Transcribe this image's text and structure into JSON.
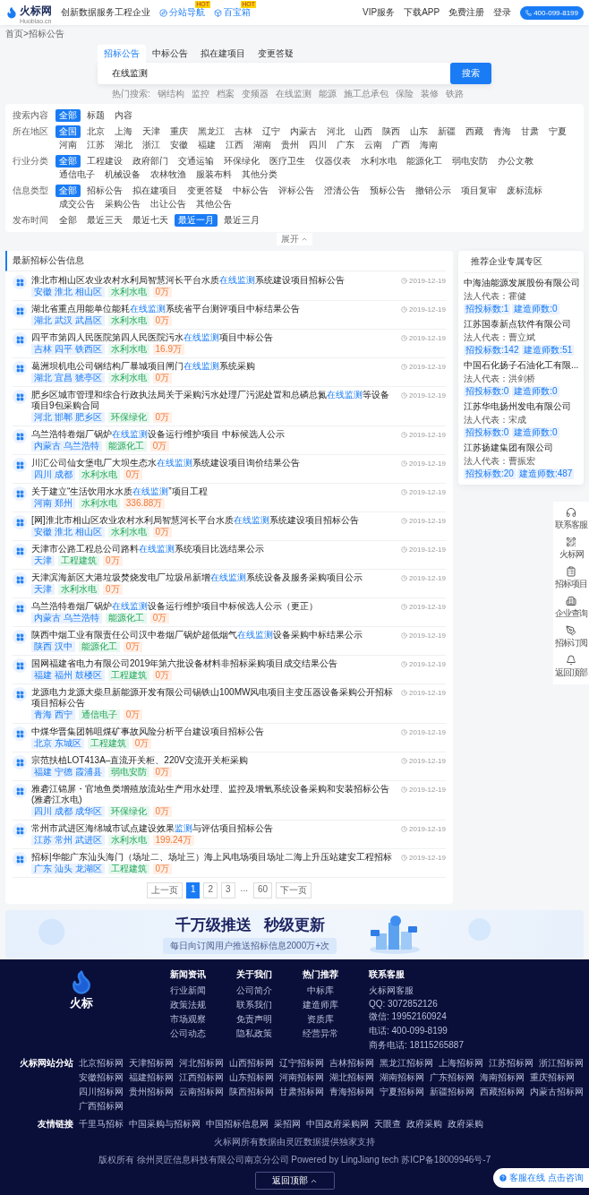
{
  "header": {
    "logo": "火标网",
    "logo_sub": "Huobiao.cn",
    "slogan": "创新数据服务工程企业",
    "nav": [
      {
        "label": "分站导航",
        "badge": "HOT",
        "kind": "compass"
      },
      {
        "label": "百宝箱",
        "badge": "HOT",
        "kind": "box"
      }
    ],
    "links": [
      "VIP服务",
      "下载APP"
    ],
    "register": "免费注册",
    "login": "登录",
    "phone": "400-099-8199"
  },
  "breadcrumb": "首页>招标公告",
  "search": {
    "tabs": [
      {
        "label": "招标公告",
        "selected": true
      },
      {
        "label": "中标公告",
        "selected": false
      },
      {
        "label": "拟在建项目",
        "selected": false
      },
      {
        "label": "变更答疑",
        "selected": false
      }
    ],
    "value": "在线监测",
    "button": "搜索",
    "hot_label": "热门搜索:",
    "hot": [
      "钢结构",
      "监控",
      "档案",
      "变频器",
      "在线监测",
      "能源",
      "施工总承包",
      "保险",
      "装修",
      "铁路"
    ]
  },
  "filters": [
    {
      "label": "搜索内容",
      "options": [
        {
          "label": "全部",
          "selected": true
        },
        {
          "label": "标题",
          "selected": false
        },
        {
          "label": "内容",
          "selected": false
        }
      ]
    },
    {
      "label": "所在地区",
      "options": [
        {
          "label": "全国",
          "selected": true
        },
        {
          "label": "北京",
          "selected": false
        },
        {
          "label": "上海",
          "selected": false
        },
        {
          "label": "天津",
          "selected": false
        },
        {
          "label": "重庆",
          "selected": false
        },
        {
          "label": "黑龙江",
          "selected": false
        },
        {
          "label": "吉林",
          "selected": false
        },
        {
          "label": "辽宁",
          "selected": false
        },
        {
          "label": "内蒙古",
          "selected": false
        },
        {
          "label": "河北",
          "selected": false
        },
        {
          "label": "山西",
          "selected": false
        },
        {
          "label": "陕西",
          "selected": false
        },
        {
          "label": "山东",
          "selected": false
        },
        {
          "label": "新疆",
          "selected": false
        },
        {
          "label": "西藏",
          "selected": false
        },
        {
          "label": "青海",
          "selected": false
        },
        {
          "label": "甘肃",
          "selected": false
        },
        {
          "label": "宁夏",
          "selected": false
        },
        {
          "label": "河南",
          "selected": false
        },
        {
          "label": "江苏",
          "selected": false
        },
        {
          "label": "湖北",
          "selected": false
        },
        {
          "label": "浙江",
          "selected": false
        },
        {
          "label": "安徽",
          "selected": false
        },
        {
          "label": "福建",
          "selected": false
        },
        {
          "label": "江西",
          "selected": false
        },
        {
          "label": "湖南",
          "selected": false
        },
        {
          "label": "贵州",
          "selected": false
        },
        {
          "label": "四川",
          "selected": false
        },
        {
          "label": "广东",
          "selected": false
        },
        {
          "label": "云南",
          "selected": false
        },
        {
          "label": "广西",
          "selected": false
        },
        {
          "label": "海南",
          "selected": false
        }
      ]
    },
    {
      "label": "行业分类",
      "options": [
        {
          "label": "全部",
          "selected": true
        },
        {
          "label": "工程建设",
          "selected": false
        },
        {
          "label": "政府部门",
          "selected": false
        },
        {
          "label": "交通运输",
          "selected": false
        },
        {
          "label": "环保绿化",
          "selected": false
        },
        {
          "label": "医疗卫生",
          "selected": false
        },
        {
          "label": "仪器仪表",
          "selected": false
        },
        {
          "label": "水利水电",
          "selected": false
        },
        {
          "label": "能源化工",
          "selected": false
        },
        {
          "label": "弱电安防",
          "selected": false
        },
        {
          "label": "办公文教",
          "selected": false
        },
        {
          "label": "通信电子",
          "selected": false
        },
        {
          "label": "机械设备",
          "selected": false
        },
        {
          "label": "农林牧渔",
          "selected": false
        },
        {
          "label": "服装布料",
          "selected": false
        },
        {
          "label": "其他分类",
          "selected": false
        }
      ]
    },
    {
      "label": "信息类型",
      "options": [
        {
          "label": "全部",
          "selected": true
        },
        {
          "label": "招标公告",
          "selected": false
        },
        {
          "label": "拟在建项目",
          "selected": false
        },
        {
          "label": "变更答疑",
          "selected": false
        },
        {
          "label": "中标公告",
          "selected": false
        },
        {
          "label": "评标公告",
          "selected": false
        },
        {
          "label": "澄清公告",
          "selected": false
        },
        {
          "label": "预标公告",
          "selected": false
        },
        {
          "label": "撤销公示",
          "selected": false
        },
        {
          "label": "项目复审",
          "selected": false
        },
        {
          "label": "废标流标",
          "selected": false
        },
        {
          "label": "成交公告",
          "selected": false
        },
        {
          "label": "采购公告",
          "selected": false
        },
        {
          "label": "出让公告",
          "selected": false
        },
        {
          "label": "其他公告",
          "selected": false
        }
      ]
    },
    {
      "label": "发布时间",
      "options": [
        {
          "label": "全部",
          "selected": false
        },
        {
          "label": "最近三天",
          "selected": false
        },
        {
          "label": "最近七天",
          "selected": false
        },
        {
          "label": "最近一月",
          "selected": true
        },
        {
          "label": "最近三月",
          "selected": false
        }
      ]
    }
  ],
  "expand": "展开",
  "list": {
    "title": "最新招标公告信息",
    "items": [
      {
        "title": "淮北市相山区农业农村水利局智慧河长平台水质**在线监测**系统建设项目招标公告",
        "date": "2019-12-19",
        "tags": [
          {
            "kind": "region",
            "text": "安徽 淮北 相山区"
          },
          {
            "kind": "industry",
            "text": "水利水电"
          },
          {
            "kind": "amount",
            "text": "0万"
          }
        ]
      },
      {
        "title": "湖北省重点用能单位能耗**在线监测**系统省平台测评项目中标结果公告",
        "date": "2019-12-19",
        "tags": [
          {
            "kind": "region",
            "text": "湖北 武汉 武昌区"
          },
          {
            "kind": "industry",
            "text": "水利水电"
          },
          {
            "kind": "amount",
            "text": "0万"
          }
        ]
      },
      {
        "title": "四平市第四人民医院第四人民医院污水**在线监测**项目中标公告",
        "date": "2019-12-19",
        "tags": [
          {
            "kind": "region",
            "text": "吉林 四平 铁西区"
          },
          {
            "kind": "industry",
            "text": "水利水电"
          },
          {
            "kind": "amount",
            "text": "16.9万"
          }
        ]
      },
      {
        "title": "葛洲坝机电公司钢结构厂暴城项目闸门**在线监测**系统采购",
        "date": "2019-12-19",
        "tags": [
          {
            "kind": "region",
            "text": "湖北 宜昌 猇亭区"
          },
          {
            "kind": "industry",
            "text": "水利水电"
          },
          {
            "kind": "amount",
            "text": "0万"
          }
        ]
      },
      {
        "title": "肥乡区城市管理和综合行政执法局关于采购污水处理厂污泥处置和总磷总氮**在线监测**等设备项目9包采购合同",
        "date": "2019-12-19",
        "tags": [
          {
            "kind": "region",
            "text": "河北 邯郸 肥乡区"
          },
          {
            "kind": "industry",
            "text": "环保绿化"
          },
          {
            "kind": "amount",
            "text": "0万"
          }
        ]
      },
      {
        "title": "乌兰浩特卷烟厂锅炉**在线监测**设备运行维护项目 中标候选人公示",
        "date": "2019-12-19",
        "tags": [
          {
            "kind": "region",
            "text": "内蒙古 乌兰浩特"
          },
          {
            "kind": "industry",
            "text": "能源化工"
          },
          {
            "kind": "amount",
            "text": "0万"
          }
        ]
      },
      {
        "title": "川汇公司仙女堡电厂大坝生态水**在线监测**系统建设项目询价结果公告",
        "date": "2019-12-19",
        "tags": [
          {
            "kind": "region",
            "text": "四川 成都"
          },
          {
            "kind": "industry",
            "text": "水利水电"
          },
          {
            "kind": "amount",
            "text": "0万"
          }
        ]
      },
      {
        "title": "关于建立“生活饮用水水质**在线监测**”项目工程",
        "date": "2019-12-19",
        "tags": [
          {
            "kind": "region",
            "text": "河南 郑州"
          },
          {
            "kind": "industry",
            "text": "水利水电"
          },
          {
            "kind": "amount",
            "text": "336.88万"
          }
        ]
      },
      {
        "title": "[网]淮北市相山区农业农村水利局智慧河长平台水质**在线监测**系统建设项目招标公告",
        "date": "2019-12-19",
        "tags": [
          {
            "kind": "region",
            "text": "安徽 淮北 相山区"
          },
          {
            "kind": "industry",
            "text": "水利水电"
          },
          {
            "kind": "amount",
            "text": "0万"
          }
        ]
      },
      {
        "title": "天津市公路工程总公司路料**在线监测**系统项目比选结果公示",
        "date": "2019-12-19",
        "tags": [
          {
            "kind": "region",
            "text": "天津"
          },
          {
            "kind": "industry",
            "text": "工程建筑"
          },
          {
            "kind": "amount",
            "text": "0万"
          }
        ]
      },
      {
        "title": "天津滨海新区大港垃圾焚烧发电厂垃圾吊新增**在线监测**系统设备及服务采购项目公示",
        "date": "2019-12-19",
        "tags": [
          {
            "kind": "region",
            "text": "天津"
          },
          {
            "kind": "industry",
            "text": "水利水电"
          },
          {
            "kind": "amount",
            "text": "0万"
          }
        ]
      },
      {
        "title": "乌兰浩特卷烟厂锅炉**在线监测**设备运行维护项目中标候选人公示（更正）",
        "date": "2019-12-19",
        "tags": [
          {
            "kind": "region",
            "text": "内蒙古 乌兰浩特"
          },
          {
            "kind": "industry",
            "text": "能源化工"
          },
          {
            "kind": "amount",
            "text": "0万"
          }
        ]
      },
      {
        "title": "陕西中烟工业有限责任公司汉中卷烟厂锅炉超低烟气**在线监测**设备采购中标结果公示",
        "date": "2019-12-19",
        "tags": [
          {
            "kind": "region",
            "text": "陕西 汉中"
          },
          {
            "kind": "industry",
            "text": "能源化工"
          },
          {
            "kind": "amount",
            "text": "0万"
          }
        ]
      },
      {
        "title": "国网福建省电力有限公司2019年第六批设备材料非招标采购项目成交结果公告",
        "date": "2019-12-19",
        "tags": [
          {
            "kind": "region",
            "text": "福建 福州 鼓楼区"
          },
          {
            "kind": "industry",
            "text": "工程建筑"
          },
          {
            "kind": "amount",
            "text": "0万"
          }
        ]
      },
      {
        "title": "龙源电力龙源大柴旦新能源开发有限公司锡铁山100MW风电项目主变压器设备采购公开招标项目招标公告",
        "date": "2019-12-19",
        "tags": [
          {
            "kind": "region",
            "text": "青海 西宁"
          },
          {
            "kind": "industry",
            "text": "通信电子"
          },
          {
            "kind": "amount",
            "text": "0万"
          }
        ]
      },
      {
        "title": "中煤华晋集团韩咀煤矿事故风险分析平台建设项目招标公告",
        "date": "2019-12-19",
        "tags": [
          {
            "kind": "region",
            "text": "北京 东城区"
          },
          {
            "kind": "industry",
            "text": "工程建筑"
          },
          {
            "kind": "amount",
            "text": "0万"
          }
        ]
      },
      {
        "title": "宗范扶植LOT413A–直流开关柜、220V交流开关柜采购",
        "date": "2019-12-19",
        "tags": [
          {
            "kind": "region",
            "text": "福建 宁德 霞浦县"
          },
          {
            "kind": "industry",
            "text": "弱电安防"
          },
          {
            "kind": "amount",
            "text": "0万"
          }
        ]
      },
      {
        "title": "雅砻江锦屏・官地鱼类增殖放流站生产用水处理、监控及增氧系统设备采购和安装招标公告(雅砻江水电)",
        "date": "2019-12-19",
        "tags": [
          {
            "kind": "region",
            "text": "四川 成都 成华区"
          },
          {
            "kind": "industry",
            "text": "环保绿化"
          },
          {
            "kind": "amount",
            "text": "0万"
          }
        ]
      },
      {
        "title": "常州市武进区海绵城市试点建设效果**监测**与评估项目招标公告",
        "date": "2019-12-19",
        "tags": [
          {
            "kind": "region",
            "text": "江苏 常州 武进区"
          },
          {
            "kind": "industry",
            "text": "水利水电"
          },
          {
            "kind": "amount",
            "text": "199.24万"
          }
        ]
      },
      {
        "title": "招标|华能广东汕头海门（场址二、场址三）海上风电场项目场址二海上升压站建安工程招标",
        "date": "2019-12-19",
        "tags": [
          {
            "kind": "region",
            "text": "广东 汕头 龙湖区"
          },
          {
            "kind": "industry",
            "text": "工程建筑"
          },
          {
            "kind": "amount",
            "text": "0万"
          }
        ]
      }
    ]
  },
  "pagination": {
    "prev": "上一页",
    "next": "下一页",
    "pages": [
      {
        "label": "1",
        "kind": "page",
        "selected": true
      },
      {
        "label": "2",
        "kind": "page",
        "selected": false
      },
      {
        "label": "3",
        "kind": "page",
        "selected": false
      },
      {
        "label": "...",
        "kind": "gap",
        "selected": false
      },
      {
        "label": "60",
        "kind": "page",
        "selected": false
      }
    ]
  },
  "sidebar": {
    "title": "推荐企业专属专区",
    "companies": [
      {
        "name": "中海油能源发展股份有限公司",
        "rep": "法人代表：霍健",
        "stats": [
          "招投标数:1",
          "建造师数:0"
        ]
      },
      {
        "name": "江苏国泰新点软件有限公司",
        "rep": "法人代表：曹立斌",
        "stats": [
          "招投标数:142",
          "建造师数:51"
        ]
      },
      {
        "name": "中国石化扬子石油化工有限...",
        "rep": "法人代表：洪剑桥",
        "stats": [
          "招投标数:0",
          "建造师数:0"
        ]
      },
      {
        "name": "江苏华电扬州发电有限公司",
        "rep": "法人代表：宋成",
        "stats": [
          "招投标数:0",
          "建造师数:0"
        ]
      },
      {
        "name": "江苏扬建集团有限公司",
        "rep": "法人代表：曹振宏",
        "stats": [
          "招投标数:20",
          "建造师数:487"
        ]
      }
    ]
  },
  "banner": {
    "headline": [
      "千万级推送",
      "秒级更新"
    ],
    "subline": "每日向订阅用户推送招标信息2000万+次"
  },
  "tools": [
    {
      "kind": "headset",
      "label": "联系客服"
    },
    {
      "kind": "qrcode",
      "label": "火标网"
    },
    {
      "kind": "clipboard",
      "label": "招标项目"
    },
    {
      "kind": "building",
      "label": "企业查询"
    },
    {
      "kind": "pen",
      "label": "招标订阅"
    },
    {
      "kind": "bell",
      "label": "返回顶部"
    }
  ],
  "footer": {
    "logo": "火标",
    "columns": [
      {
        "title": "新闻资讯",
        "links": [
          "行业新闻",
          "政策法规",
          "市场观察",
          "公司动态"
        ]
      },
      {
        "title": "关于我们",
        "links": [
          "公司简介",
          "联系我们",
          "免责声明",
          "隐私政策"
        ]
      },
      {
        "title": "热门推荐",
        "links": [
          "中标库",
          "建造师库",
          "资质库",
          "经营异常"
        ]
      }
    ],
    "contact": {
      "title": "联系客服",
      "lines": [
        "火标网客服",
        "QQ: 3072852126",
        "微信: 19952160924",
        "电话: 400-099-8199",
        "商务电话: 18115265887"
      ]
    },
    "sites_label": "火标网站分站",
    "sites": [
      "北京招标网",
      "天津招标网",
      "河北招标网",
      "山西招标网",
      "辽宁招标网",
      "吉林招标网",
      "黑龙江招标网",
      "上海招标网",
      "江苏招标网",
      "浙江招标网",
      "安徽招标网",
      "福建招标网",
      "江西招标网",
      "山东招标网",
      "河南招标网",
      "湖北招标网",
      "湖南招标网",
      "广东招标网",
      "海南招标网",
      "重庆招标网",
      "四川招标网",
      "贵州招标网",
      "云南招标网",
      "陕西招标网",
      "甘肃招标网",
      "青海招标网",
      "宁夏招标网",
      "新疆招标网",
      "西藏招标网",
      "内蒙古招标网",
      "广西招标网"
    ],
    "friends_label": "友情链接",
    "friends": [
      "千里马招标",
      "中国采购与招标网",
      "中国招标信息网",
      "采招网",
      "中国政府采购网",
      "天眼查",
      "政府采购",
      "政府采购"
    ],
    "notice": "火标网所有数据由灵匠数据提供独家支持",
    "copyright": "版权所有 徐州灵匠信息科技有限公司南京分公司 Powered by LingJiang tech 苏ICP备18009946号-7",
    "top_button": "返回顶部"
  },
  "chat": "客服在线 点击咨询"
}
